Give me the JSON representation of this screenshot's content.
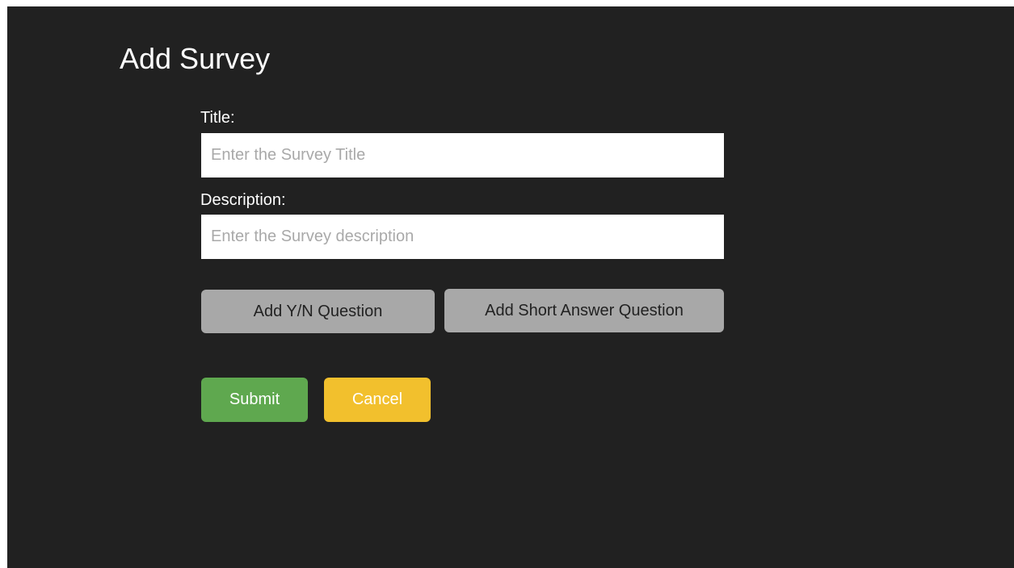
{
  "page": {
    "title": "Add Survey"
  },
  "form": {
    "title_label": "Title:",
    "title_value": "",
    "title_placeholder": "Enter the Survey Title",
    "description_label": "Description:",
    "description_value": "",
    "description_placeholder": "Enter the Survey description"
  },
  "questions": {
    "add_yn_label": "Add Y/N Question",
    "add_short_answer_label": "Add Short Answer Question"
  },
  "actions": {
    "submit_label": "Submit",
    "cancel_label": "Cancel"
  },
  "colors": {
    "background": "#212121",
    "question_button": "#a8a8a8",
    "submit_button": "#5fa84f",
    "cancel_button": "#f2c02d"
  }
}
